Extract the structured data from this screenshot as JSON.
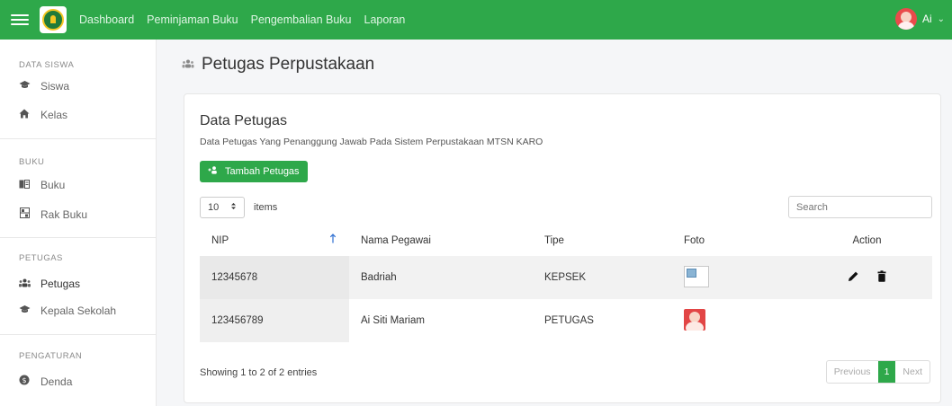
{
  "nav": {
    "items": [
      "Dashboard",
      "Peminjaman Buku",
      "Pengembalian Buku",
      "Laporan"
    ]
  },
  "user": {
    "name": "Ai",
    "caret": "⌄"
  },
  "sidebar": {
    "sections": [
      {
        "title": "DATA SISWA",
        "items": [
          {
            "label": "Siswa",
            "icon": "graduation-cap-icon"
          },
          {
            "label": "Kelas",
            "icon": "home-icon"
          }
        ]
      },
      {
        "title": "BUKU",
        "items": [
          {
            "label": "Buku",
            "icon": "book-icon"
          },
          {
            "label": "Rak Buku",
            "icon": "shelf-icon"
          }
        ]
      },
      {
        "title": "PETUGAS",
        "items": [
          {
            "label": "Petugas",
            "icon": "users-icon"
          },
          {
            "label": "Kepala Sekolah",
            "icon": "graduation-cap-icon"
          }
        ]
      },
      {
        "title": "PENGATURAN",
        "items": [
          {
            "label": "Denda",
            "icon": "dollar-icon"
          }
        ]
      }
    ]
  },
  "page": {
    "title": "Petugas Perpustakaan"
  },
  "card": {
    "title": "Data Petugas",
    "subtitle": "Data Petugas Yang Penanggung Jawab Pada Sistem Perpustakaan MTSN KARO",
    "add_button": "Tambah Petugas",
    "length_value": "10",
    "length_suffix": "items",
    "search_placeholder": "Search"
  },
  "table": {
    "headers": [
      "NIP",
      "Nama Pegawai",
      "Tipe",
      "Foto",
      "Action"
    ],
    "rows": [
      {
        "nip": "12345678",
        "nama": "Badriah",
        "tipe": "KEPSEK"
      },
      {
        "nip": "123456789",
        "nama": "Ai Siti Mariam",
        "tipe": "PETUGAS"
      }
    ]
  },
  "footer": {
    "info": "Showing 1 to 2 of 2 entries",
    "prev": "Previous",
    "current_page": "1",
    "next": "Next"
  },
  "colors": {
    "brand": "#2ea84a",
    "link": "#2e6fd1"
  }
}
